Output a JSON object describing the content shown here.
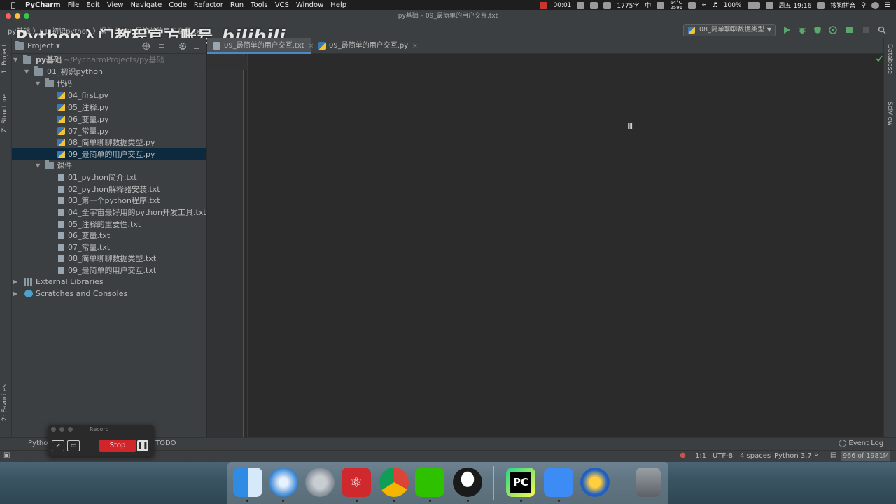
{
  "menubar": {
    "app": "PyCharm",
    "items": [
      "File",
      "Edit",
      "View",
      "Navigate",
      "Code",
      "Refactor",
      "Run",
      "Tools",
      "VCS",
      "Window",
      "Help"
    ],
    "status": {
      "record_time": "00:01",
      "word_count": "1775字",
      "ime": "中",
      "temp": "64°C",
      "fan": "2591",
      "battery": "100%",
      "datetime": "周五 19:16",
      "input_method": "搜狗拼音"
    }
  },
  "window": {
    "title": "py基础 – 09_最简单的用户交互.txt"
  },
  "navbar": {
    "breadcrumb": "py基础 〉01_初识python 〉课件 〉09_最简单的用户交互.txt",
    "run_config": "08_简单聊聊数据类型"
  },
  "watermark": {
    "text": "Python入门教程官方账号",
    "logo": "bilibili"
  },
  "sidebars": {
    "left_tabs": [
      "1: Project",
      "Z: Structure",
      "2: Favorites"
    ],
    "right_tabs": [
      "Database",
      "SciView"
    ]
  },
  "project": {
    "header": "Project",
    "root_name": "py基础",
    "root_path": "~/PycharmProjects/py基础",
    "folder1": "01_初识python",
    "code_folder": "代码",
    "code_files": [
      "04_first.py",
      "05_注释.py",
      "06_变量.py",
      "07_常量.py",
      "08_简单聊聊数据类型.py",
      "09_最简单的用户交互.py"
    ],
    "course_folder": "课件",
    "course_files": [
      "01_python简介.txt",
      "02_python解释器安装.txt",
      "03_第一个python程序.txt",
      "04_全宇宙最好用的python开发工具.txt",
      "05_注释的重要性.txt",
      "06_变量.txt",
      "07_常量.txt",
      "08_简单聊聊数据类型.txt",
      "09_最简单的用户交互.txt"
    ],
    "external_libraries": "External Libraries",
    "scratches": "Scratches and Consoles"
  },
  "editor": {
    "tabs": [
      {
        "label": "09_最简单的用户交互.txt",
        "close": "×"
      },
      {
        "label": "09_最简单的用户交互.py",
        "close": "×"
      }
    ]
  },
  "bottom_tabs": {
    "python_console": "Python",
    "todo": "TODO",
    "event_log": "Event Log"
  },
  "statusbar": {
    "position": "1:1",
    "encoding": "UTF-8",
    "indent": "4 spaces",
    "interpreter": "Python 3.7",
    "memory": "966 of 1981M"
  },
  "recorder": {
    "title": "Record",
    "stop_label": "Stop"
  },
  "dock": {
    "apps": [
      "finder-icon",
      "safari-icon",
      "launchpad-icon",
      "netease-music-icon",
      "chrome-icon",
      "wechat-icon",
      "qq-icon",
      "pycharm-icon",
      "feishu-icon",
      "thunder-icon",
      "trash-icon"
    ],
    "pycharm_label": "PC"
  }
}
